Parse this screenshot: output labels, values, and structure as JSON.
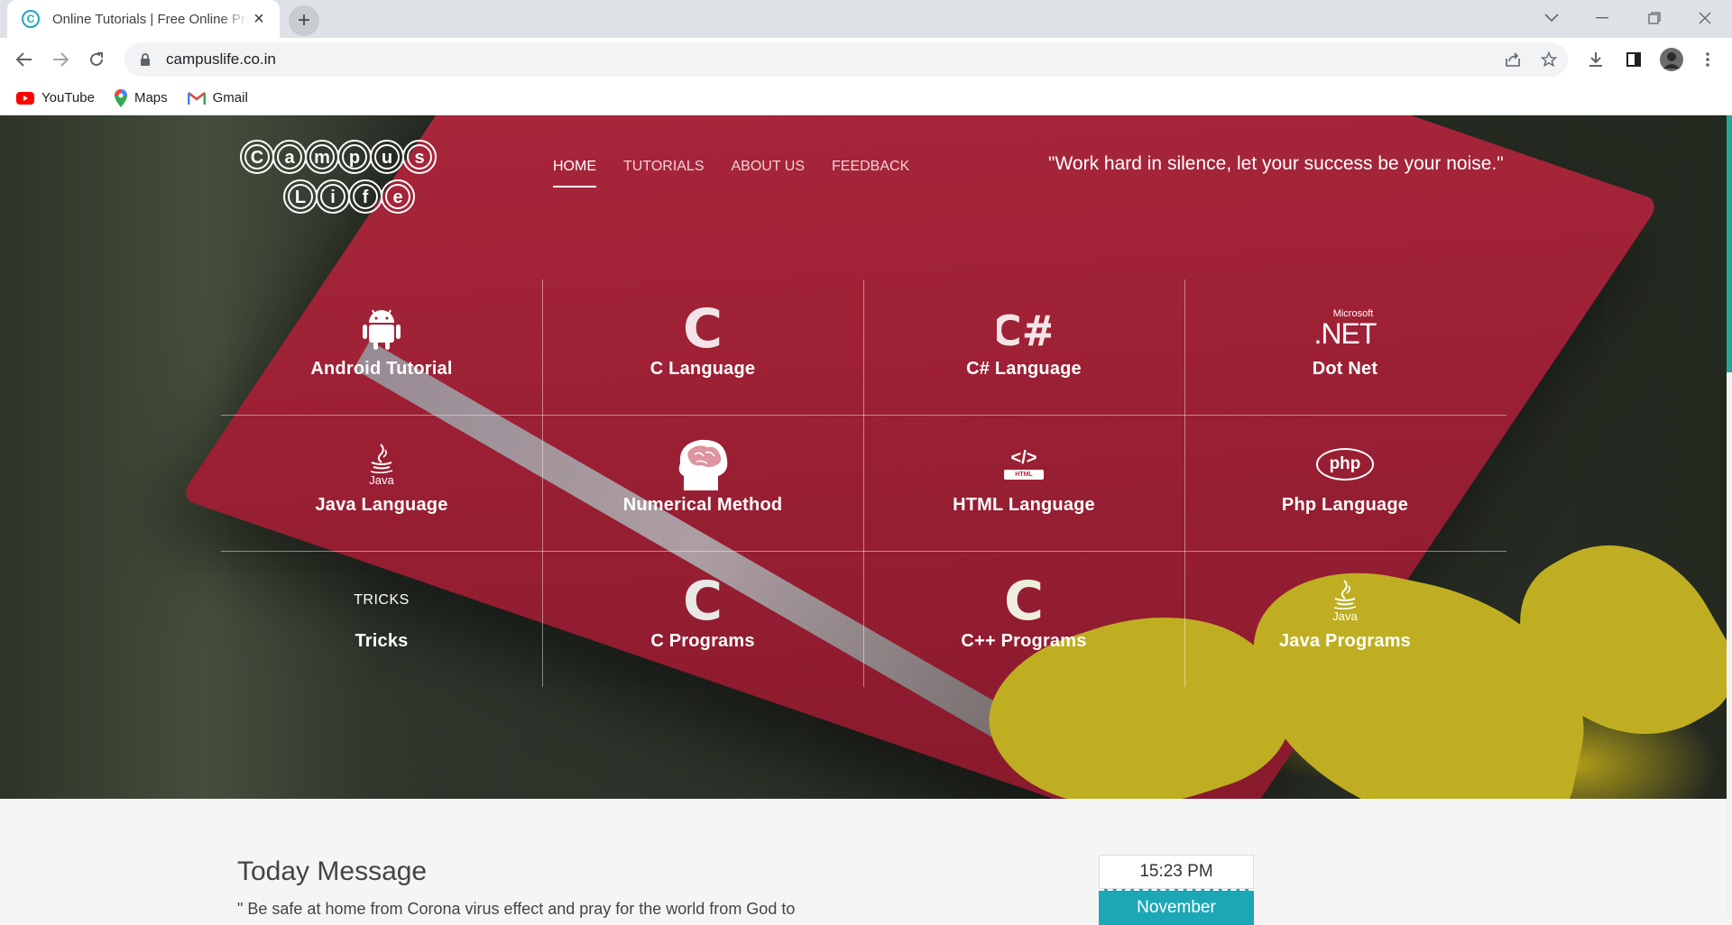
{
  "browser": {
    "tab_title": "Online Tutorials | Free Online Programming",
    "tab_favicon": "C",
    "url": "campuslife.co.in",
    "bookmarks": [
      {
        "label": "YouTube",
        "icon": "youtube-icon"
      },
      {
        "label": "Maps",
        "icon": "maps-icon"
      },
      {
        "label": "Gmail",
        "icon": "gmail-icon"
      }
    ]
  },
  "site": {
    "logo_text": "Campus Life",
    "nav": [
      "HOME",
      "TUTORIALS",
      "ABOUT US",
      "FEEDBACK"
    ],
    "quote": "\"Work hard in silence, let your success be your noise.\"",
    "tiles": [
      {
        "label": "Android Tutorial",
        "icon": "android-icon"
      },
      {
        "label": "C Language",
        "icon": "c-letter-icon"
      },
      {
        "label": "C# Language",
        "icon": "csharp-icon"
      },
      {
        "label": "Dot Net",
        "icon": "dotnet-icon"
      },
      {
        "label": "Java Language",
        "icon": "java-icon"
      },
      {
        "label": "Numerical Method",
        "icon": "brain-head-icon"
      },
      {
        "label": "HTML Language",
        "icon": "html-icon"
      },
      {
        "label": "Php Language",
        "icon": "php-icon"
      },
      {
        "label": "Tricks",
        "icon": "tricks-icon"
      },
      {
        "label": "C Programs",
        "icon": "c-letter-icon"
      },
      {
        "label": "C++ Programs",
        "icon": "c-letter-icon"
      },
      {
        "label": "Java Programs",
        "icon": "java-icon"
      }
    ],
    "icon_text": {
      "csharp": "C#",
      "dotnet_small": "Microsoft",
      "dotnet_big": ".NET",
      "java": "Java",
      "html_tag": "</>",
      "html_small": "HTML",
      "php": "php",
      "tricks": "TRICKS",
      "c": "C"
    },
    "today_message": {
      "title": "Today Message",
      "text": "\" Be safe at home from Corona virus effect and pray for the world from God to"
    },
    "clock": {
      "time": "15:23 PM",
      "month": "November"
    }
  },
  "colors": {
    "accent": "#1ca7b5",
    "scroll_thumb": "#26a69a"
  }
}
